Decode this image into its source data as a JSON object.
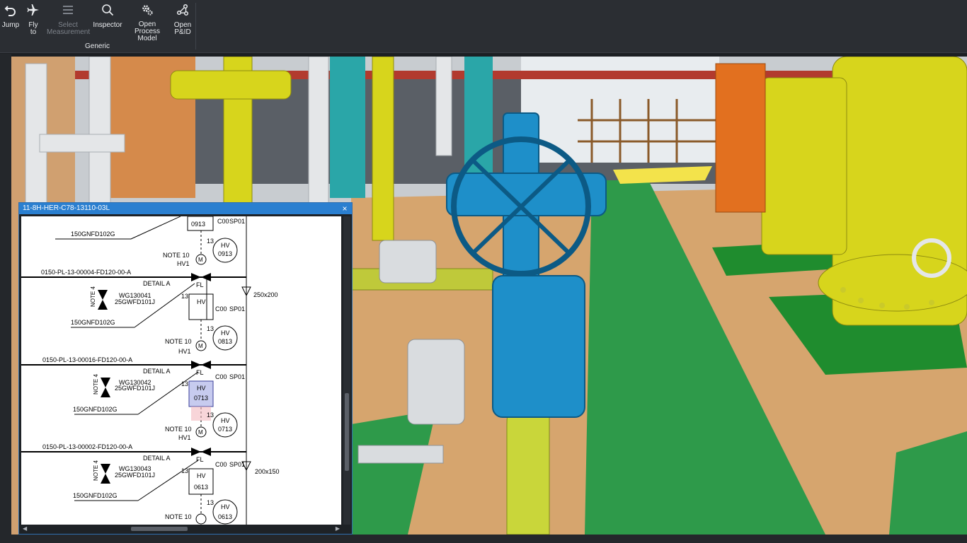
{
  "toolbar": {
    "buttons": [
      {
        "id": "jump",
        "label": "Jump",
        "icon": "undo-arrow-icon",
        "enabled": true
      },
      {
        "id": "fly",
        "label": "Fly to",
        "icon": "airplane-icon",
        "enabled": true
      },
      {
        "id": "select_measurement",
        "label": "Select Measurement",
        "icon": "menu-lines-icon",
        "enabled": false
      },
      {
        "id": "inspector",
        "label": "Inspector",
        "icon": "magnifier-icon",
        "enabled": true
      },
      {
        "id": "open_process_model",
        "label": "Open Process Model",
        "icon": "gears-icon",
        "enabled": true
      },
      {
        "id": "open_pid",
        "label": "Open P&ID",
        "icon": "nodes-icon",
        "enabled": true
      }
    ],
    "group_label": "Generic"
  },
  "pid_window": {
    "title": "11-8H-HER-C78-13110-03L",
    "labels": {
      "pipe1": "0150-PL-13-00004-FD120-00-A",
      "pipe2": "0150-PL-13-00016-FD120-00-A",
      "pipe3": "0150-PL-13-00002-FD120-00-A",
      "spec": "150GNFD102G",
      "detail": "DETAIL A",
      "note10": "NOTE 10",
      "note4": "NOTE 4",
      "hv1": "HV1",
      "fl": "FL",
      "hv": "HV",
      "m": "M",
      "n13": "13",
      "c00": "C00",
      "sp01": "SP01",
      "wg1": "WG130041",
      "wg2": "WG130042",
      "wg3": "WG130043",
      "sub": "25GWFD101J",
      "tag0913": "0913",
      "tag0813": "0813",
      "tag0713": "0713",
      "tag0613": "0613",
      "red1": "250x200",
      "red2": "200x150"
    }
  },
  "colors": {
    "accent": "#2a7fd0",
    "valve_blue": "#1e8fc9",
    "pipe_yellow": "#d7d51c",
    "floor_green": "#2e9a4a",
    "floor_tan": "#d6a56e",
    "highlight": "#7a86d8"
  }
}
